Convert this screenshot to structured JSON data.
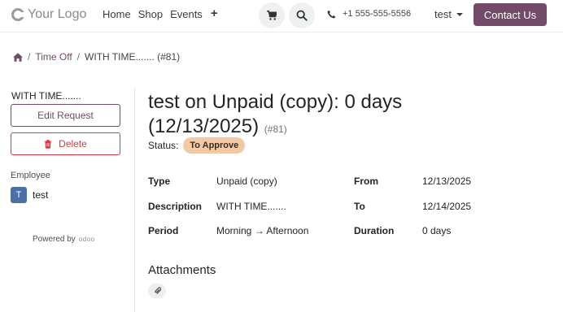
{
  "header": {
    "logo_text": "Your Logo",
    "nav": [
      "Home",
      "Shop",
      "Events"
    ],
    "nav_plus": "+",
    "cart_icon": "cart-icon",
    "search_icon": "search-icon",
    "phone": "+1 555-555-5556",
    "user": "test",
    "contact_label": "Contact Us",
    "accent_color": "#714b67"
  },
  "breadcrumb": {
    "home_icon": "home-icon",
    "items": [
      "Time Off",
      "WITH TIME....... (#81)"
    ]
  },
  "sidebar": {
    "title": "WITH TIME.......",
    "edit_label": "Edit Request",
    "delete_label": "Delete",
    "employee_label": "Employee",
    "employee_initial": "T",
    "employee_name": "test",
    "powered_by": "Powered by",
    "odoo": "odoo"
  },
  "main": {
    "title_line1": "test on Unpaid (copy): 0 days",
    "title_line2": "(12/13/2025)",
    "ref": "(#81)",
    "status_label": "Status:",
    "status_value": "To Approve",
    "status_color": "#f3c9a5",
    "fields": {
      "type_label": "Type",
      "type_value": "Unpaid (copy)",
      "description_label": "Description",
      "description_value": "WITH TIME.......",
      "period_label": "Period",
      "period_value": "Morning → Afternoon",
      "from_label": "From",
      "from_value": "12/13/2025",
      "to_label": "To",
      "to_value": "12/14/2025",
      "duration_label": "Duration",
      "duration_value": "0 days"
    },
    "attachments_title": "Attachments"
  }
}
